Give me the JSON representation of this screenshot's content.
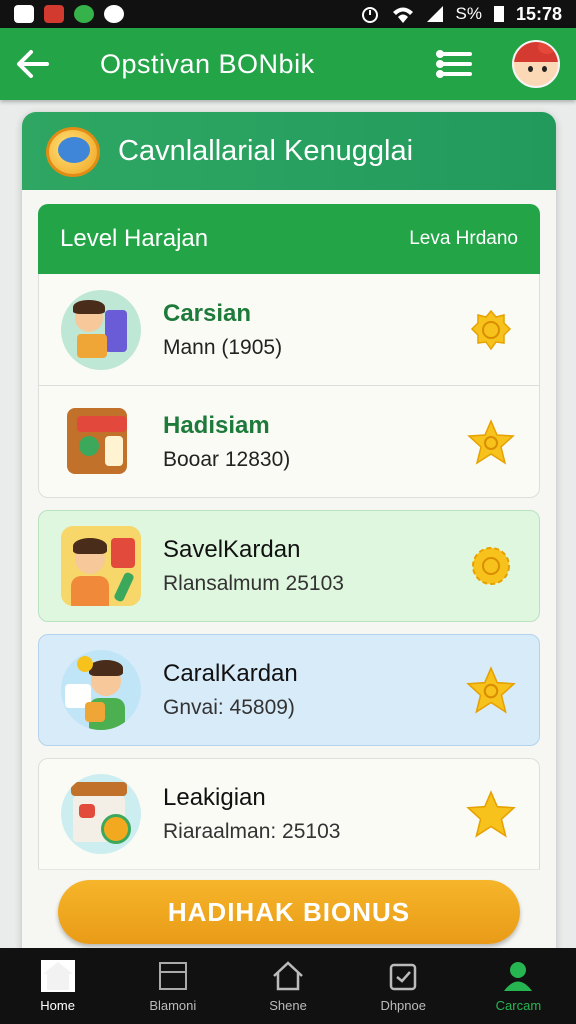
{
  "status_bar": {
    "battery_text": "S%",
    "time": "15:78"
  },
  "app_bar": {
    "title": "Opstivan  BONbik"
  },
  "card": {
    "title": "Cavnlallarial Kenugglai"
  },
  "list_header": {
    "left": "Level Harajan",
    "right": "Leva Hrdano"
  },
  "items": [
    {
      "name": "Carsian",
      "sub": "Mann (1905)"
    },
    {
      "name": "Hadisiam",
      "sub": "Booar 12830)"
    },
    {
      "name": "SavelKardan",
      "sub": "Rlansalmum 25103"
    },
    {
      "name": "CaralKardan",
      "sub": "Gnvai: 45809)"
    },
    {
      "name": "Leakigian",
      "sub": "Riaraalman: 25103"
    }
  ],
  "bonus_button": "HADIHAK BIONUS",
  "bottom_nav": [
    {
      "label": "Home"
    },
    {
      "label": "Blamoni"
    },
    {
      "label": "Shene"
    },
    {
      "label": "Dhpnoe"
    },
    {
      "label": "Carcam"
    }
  ],
  "colors": {
    "primary_green": "#22a447",
    "accent_orange": "#f2a91f",
    "star_yellow": "#f7c21c"
  }
}
